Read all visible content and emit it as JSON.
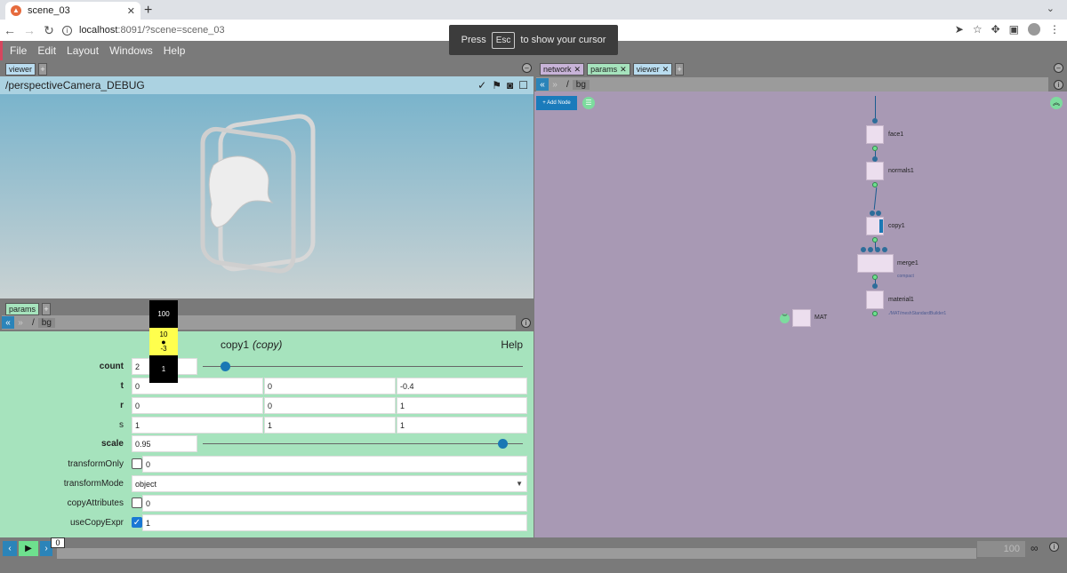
{
  "browser": {
    "tab_title": "scene_03",
    "favicon_glyph": "▲",
    "url_host": "localhost",
    "url_path": ":8091/?scene=scene_03",
    "cursor_hint_pre": "Press",
    "cursor_hint_key": "Esc",
    "cursor_hint_post": "to show your cursor"
  },
  "menu": [
    "File",
    "Edit",
    "Layout",
    "Windows",
    "Help"
  ],
  "viewer": {
    "tab_label": "viewer",
    "camera_path": "/perspectiveCamera_DEBUG"
  },
  "params_panel": {
    "tab_label": "params",
    "path_segment": "bg",
    "node_name": "copy1",
    "node_type": "(copy)",
    "help_label": "Help",
    "count": {
      "label": "count",
      "value": "2",
      "slider": 0.06
    },
    "t": {
      "label": "t",
      "x": "0",
      "y": "0",
      "z": "-0.4"
    },
    "r": {
      "label": "r",
      "x": "0",
      "y": "0",
      "z": "1"
    },
    "s": {
      "label": "s",
      "x": "1",
      "y": "1",
      "z": "1"
    },
    "scale": {
      "label": "scale",
      "value": "0.95",
      "slider": 0.94
    },
    "transformOnly": {
      "label": "transformOnly",
      "value": "0",
      "checked": false
    },
    "transformMode": {
      "label": "transformMode",
      "value": "object"
    },
    "copyAttributes": {
      "label": "copyAttributes",
      "value": "0",
      "checked": false
    },
    "useCopyExpr": {
      "label": "useCopyExpr",
      "value": "1",
      "checked": true
    }
  },
  "ladder": [
    "100",
    "10",
    "-3",
    "1"
  ],
  "network_panel": {
    "tabs": [
      "network",
      "params",
      "viewer"
    ],
    "path_separator": "/",
    "path_segment": "bg",
    "add_node_label": "+ Add Node",
    "nodes": {
      "face": "face1",
      "normals": "normals1",
      "copy": "copy1",
      "merge": "merge1",
      "merge_sub": "compact",
      "material": "material1",
      "material_sub": "./MAT/meshStandardBuilder1",
      "mat": "MAT"
    }
  },
  "timeline": {
    "current_frame": "0",
    "end_frame": "100",
    "loop_icon": "∞"
  }
}
